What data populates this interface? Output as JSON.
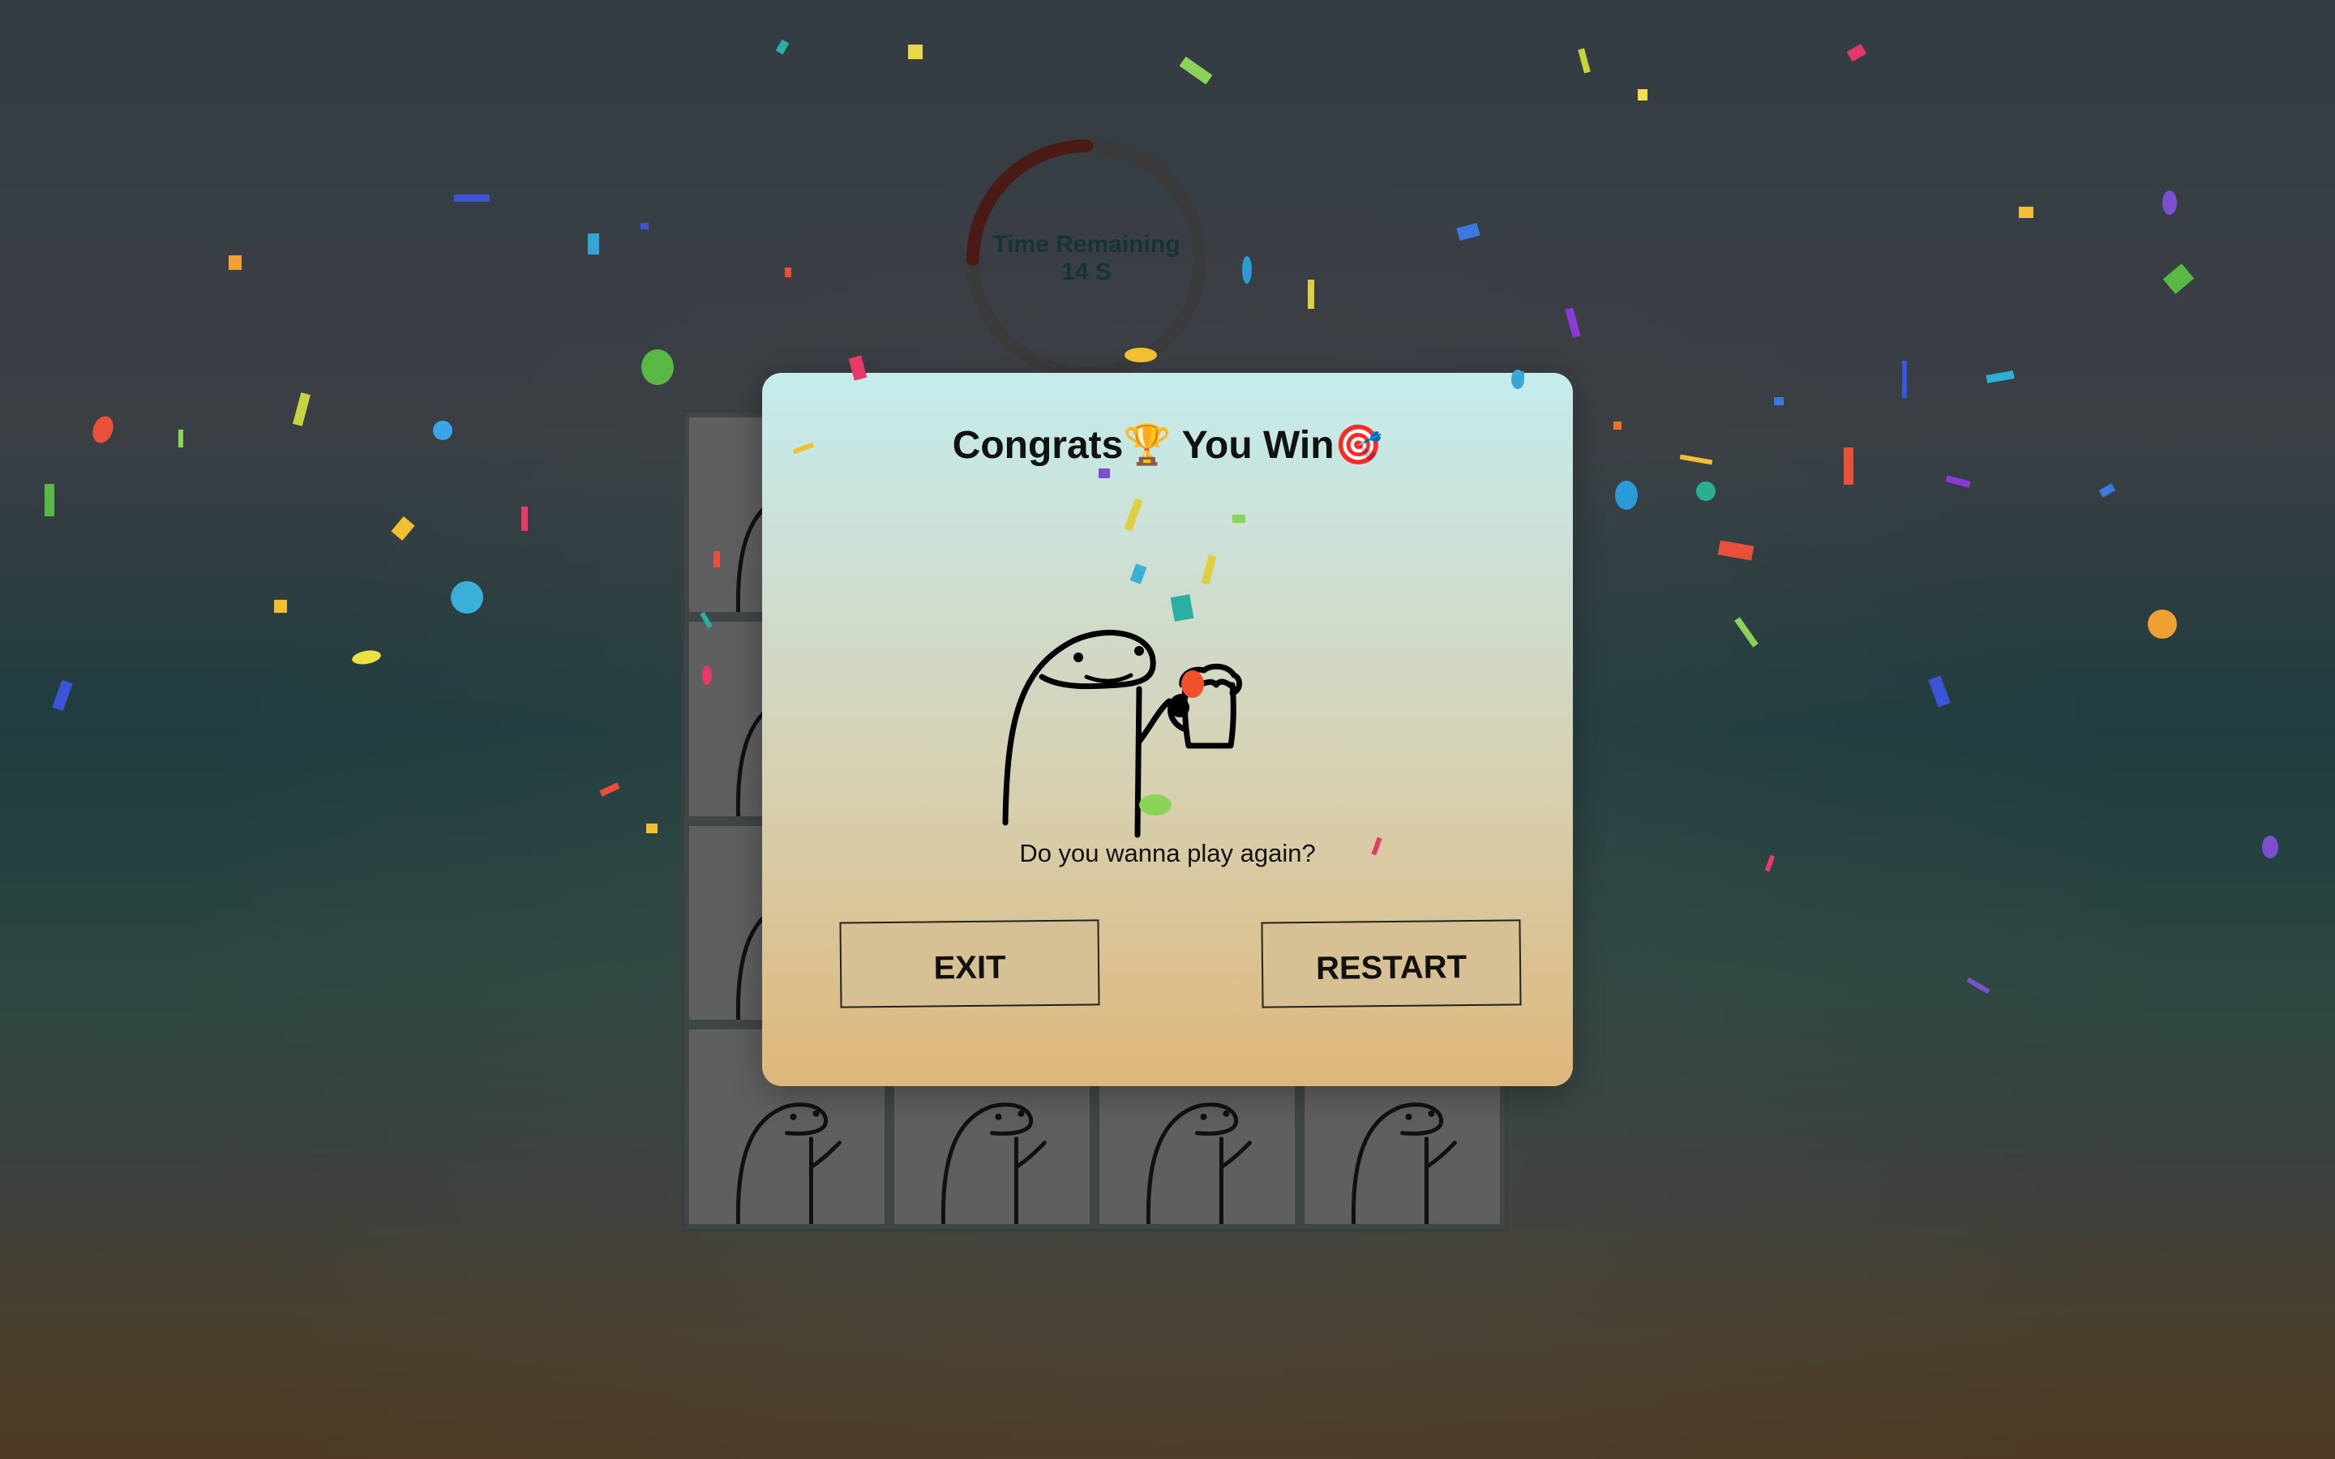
{
  "timer": {
    "label": "Time Remaining",
    "value": "14 S",
    "remaining_fraction": 0.25,
    "ring_color": "#4a1a14",
    "track_color": "#3b3b3b"
  },
  "board": {
    "rows": 4,
    "columns": 4,
    "card_icon": "doodle-character"
  },
  "modal": {
    "title": "Congrats🏆 You Win🎯",
    "illustration": "doodle-character-with-beer-mug",
    "question": "Do you wanna play again?",
    "exit_label": "EXIT",
    "restart_label": "RESTART"
  },
  "colors": {
    "modal_top": "#c4ecec",
    "modal_bottom": "#deb77a",
    "button_bg": "#d7c094"
  }
}
